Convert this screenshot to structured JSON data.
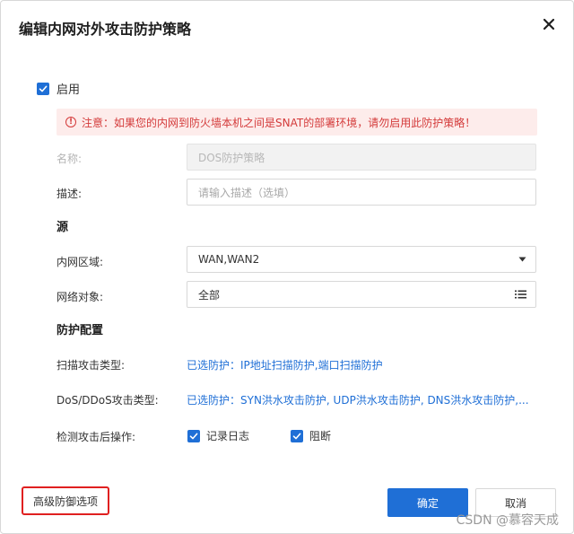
{
  "dialog": {
    "title": "编辑内网对外攻击防护策略",
    "close_icon": "close-icon"
  },
  "enable": {
    "label": "启用",
    "checked": true
  },
  "alert": {
    "icon": "info-icon",
    "icon_glyph": "!",
    "text": "注意：如果您的内网到防火墙本机之间是SNAT的部署环境，请勿启用此防护策略！"
  },
  "form": {
    "name": {
      "label": "名称:",
      "value": "DOS防护策略",
      "disabled": true
    },
    "description": {
      "label": "描述:",
      "placeholder": "请输入描述（选填）"
    }
  },
  "source": {
    "heading": "源",
    "zone": {
      "label": "内网区域:",
      "value": "WAN,WAN2",
      "icon": "caret-down-icon"
    },
    "network_object": {
      "label": "网络对象:",
      "value": "全部",
      "icon": "list-icon"
    }
  },
  "protection": {
    "heading": "防护配置",
    "scan_type": {
      "label": "扫描攻击类型:",
      "value": "已选防护：IP地址扫描防护,端口扫描防护"
    },
    "dos_type": {
      "label": "DoS/DDoS攻击类型:",
      "value": "已选防护：SYN洪水攻击防护, UDP洪水攻击防护, DNS洪水攻击防护,..."
    },
    "action": {
      "label": "检测攻击后操作:",
      "options": [
        {
          "label": "记录日志",
          "checked": true
        },
        {
          "label": "阻断",
          "checked": true
        }
      ]
    }
  },
  "footer": {
    "advanced_label": "高级防御选项",
    "confirm_label": "确定",
    "cancel_label": "取消"
  },
  "watermark": "CSDN @慕容天成",
  "colors": {
    "primary": "#1f6fd6",
    "alert_bg": "#fdeceb",
    "alert_text": "#d43a3a",
    "highlight_border": "#e02020"
  }
}
